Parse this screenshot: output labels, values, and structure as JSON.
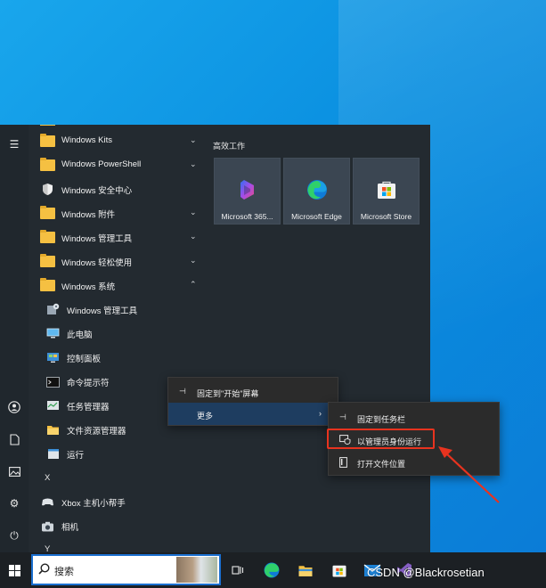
{
  "start_menu": {
    "apps": [
      {
        "label": "Windows Kits",
        "kind": "folder",
        "chevron": "⌄"
      },
      {
        "label": "Windows PowerShell",
        "kind": "folder",
        "chevron": "⌄"
      },
      {
        "label": "Windows 安全中心",
        "kind": "shield-icon"
      },
      {
        "label": "Windows 附件",
        "kind": "folder",
        "chevron": "⌄"
      },
      {
        "label": "Windows 管理工具",
        "kind": "folder",
        "chevron": "⌄"
      },
      {
        "label": "Windows 轻松使用",
        "kind": "folder",
        "chevron": "⌄"
      },
      {
        "label": "Windows 系统",
        "kind": "folder",
        "chevron": "⌃"
      },
      {
        "label": "Windows 管理工具",
        "kind": "admin-tools-icon",
        "sub": true
      },
      {
        "label": "此电脑",
        "kind": "this-pc-icon",
        "sub": true
      },
      {
        "label": "控制面板",
        "kind": "control-panel-icon",
        "sub": true
      },
      {
        "label": "命令提示符",
        "kind": "command-prompt-icon",
        "sub": true
      },
      {
        "label": "任务管理器",
        "kind": "task-manager-icon",
        "sub": true
      },
      {
        "label": "文件资源管理器",
        "kind": "file-explorer-icon",
        "sub": true
      },
      {
        "label": "运行",
        "kind": "run-icon",
        "sub": true
      }
    ],
    "letter_x": "X",
    "xbox_app": "Xbox 主机小帮手",
    "camera_app": "相机",
    "letter_y": "Y",
    "tiles_title": "高效工作",
    "tiles": [
      {
        "label": "Microsoft 365...",
        "icon": "microsoft-365-icon"
      },
      {
        "label": "Microsoft Edge",
        "icon": "edge-icon"
      },
      {
        "label": "Microsoft Store",
        "icon": "store-icon"
      }
    ]
  },
  "context_menu": {
    "pin_start": "固定到\"开始\"屏幕",
    "more": "更多",
    "submenu": {
      "pin_taskbar": "固定到任务栏",
      "run_as_admin": "以管理员身份运行",
      "open_location": "打开文件位置"
    }
  },
  "taskbar": {
    "search_placeholder": "搜索"
  },
  "watermark": "CSDN @Blackrosetian",
  "colors": {
    "desktop": "#0a8fe0",
    "start_menu_bg": "#232a30",
    "highlight": "#e8331f",
    "hover": "#1e3d60"
  }
}
